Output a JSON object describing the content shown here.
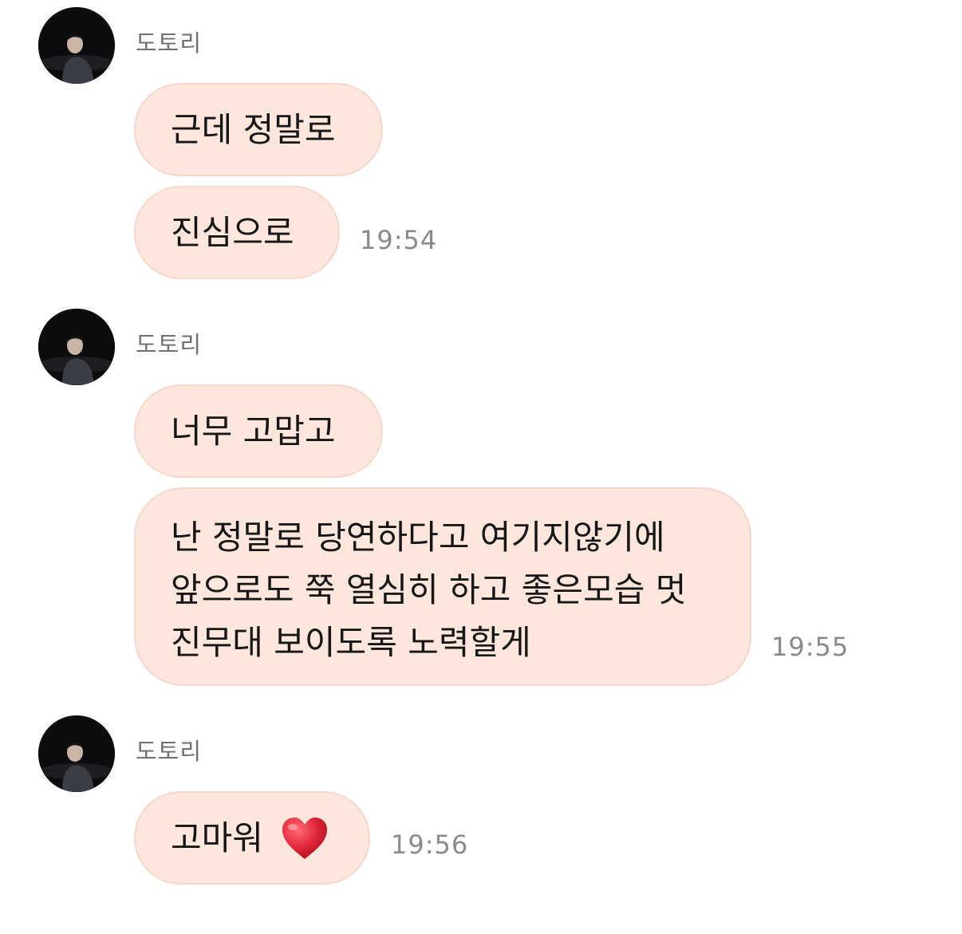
{
  "chat": {
    "groups": [
      {
        "sender": "도토리",
        "messages": [
          "근데 정말로",
          "진심으로"
        ],
        "time": "19:54"
      },
      {
        "sender": "도토리",
        "messages": [
          "너무 고맙고",
          [
            "난 정말로 당연하다고 여기지않기에",
            "앞으로도 쭉 열심히 하고 좋은모습 멋",
            "진무대 보이도록 노력할게"
          ]
        ],
        "time": "19:55"
      },
      {
        "sender": "도토리",
        "messages": [
          "고마워"
        ],
        "emoji": "heart-emoji",
        "time": "19:56"
      }
    ]
  },
  "colors": {
    "bubble_bg": "#fde6dc",
    "bubble_border": "#f7d7c9",
    "sender_text": "#6f6f6f",
    "time_text": "#8a8a8a",
    "message_text": "#161616",
    "heart": "#e2283a"
  }
}
